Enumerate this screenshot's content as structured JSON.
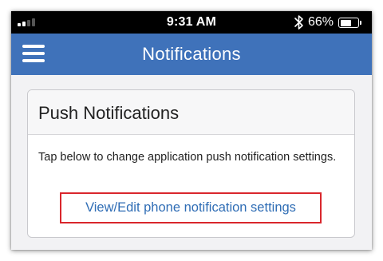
{
  "status_bar": {
    "time": "9:31 AM",
    "battery_percent": "66%",
    "battery_level": 0.66,
    "signal_bars_on": 2,
    "icons": [
      "signal-icon",
      "bluetooth-icon",
      "battery-icon"
    ]
  },
  "nav": {
    "title": "Notifications",
    "menu_icon": "hamburger-menu-icon",
    "color": "#3f72ba"
  },
  "card": {
    "title": "Push Notifications",
    "description": "Tap below to change application push notification settings.",
    "link_label": "View/Edit phone notification settings",
    "link_color": "#2f6db5",
    "highlight_color": "#d9262c"
  }
}
